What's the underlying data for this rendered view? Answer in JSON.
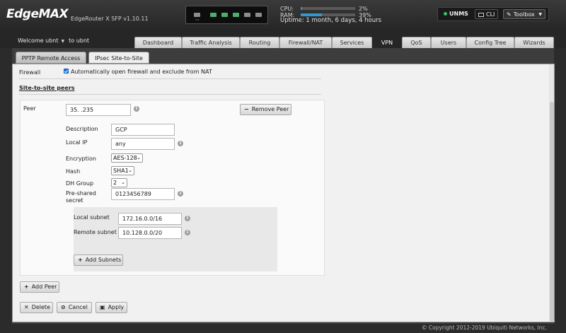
{
  "header": {
    "logo": "EdgeMAX",
    "product": "EdgeRouter X SFP v1.10.11",
    "ports_label": "SFP",
    "stats": [
      {
        "key": "CPU:",
        "value": "2%",
        "fraction": 0.02
      },
      {
        "key": "RAM:",
        "value": "39%",
        "fraction": 0.39
      }
    ],
    "uptime": "Uptime: 1 month, 6 days, 4 hours",
    "unms_label": "UNMS",
    "cli_label": "CLI",
    "toolbox_label": "Toolbox"
  },
  "nav": {
    "welcome": "Welcome ubnt",
    "user_link": "to ubnt",
    "tabs": [
      "Dashboard",
      "Traffic Analysis",
      "Routing",
      "Firewall/NAT",
      "Services",
      "VPN",
      "QoS",
      "Users",
      "Config Tree",
      "Wizards"
    ],
    "active_tab": "VPN"
  },
  "subtabs": [
    "PPTP Remote Access",
    "IPsec Site-to-Site"
  ],
  "form": {
    "firewall_label": "Firewall",
    "firewall_checkbox_label": "Automatically open firewall and exclude from NAT",
    "firewall_checked": true,
    "section_title": "Site-to-site peers",
    "peer_label": "Peer",
    "peer_value": "35.        .235",
    "remove_peer": "Remove Peer",
    "description_label": "Description",
    "description_value": "GCP",
    "local_ip_label": "Local IP",
    "local_ip_value": "any",
    "encryption_label": "Encryption",
    "encryption_value": "AES-128",
    "hash_label": "Hash",
    "hash_value": "SHA1",
    "dh_label": "DH Group",
    "dh_value": "2",
    "psk_label_1": "Pre-shared",
    "psk_label_2": "secret",
    "psk_value": "0123456789",
    "local_subnet_label": "Local subnet",
    "local_subnet_value": "172.16.0.0/16",
    "remote_subnet_label": "Remote subnet",
    "remote_subnet_value": "10.128.0.0/20",
    "add_subnets": "Add Subnets",
    "add_peer": "Add Peer",
    "delete": "Delete",
    "cancel": "Cancel",
    "apply": "Apply"
  },
  "footer": {
    "copyright": "© Copyright 2012-2019 Ubiquiti Networks, Inc."
  },
  "icons": {
    "info": "info-icon",
    "minus": "minus-icon",
    "plus": "plus-icon",
    "close": "close-icon",
    "ban": "cancel-icon",
    "save": "save-icon",
    "wrench": "wrench-icon"
  },
  "colors": {
    "accent": "#2e9ad0",
    "port_up": "#4caf6e",
    "unms_dot": "#3cc06a"
  }
}
